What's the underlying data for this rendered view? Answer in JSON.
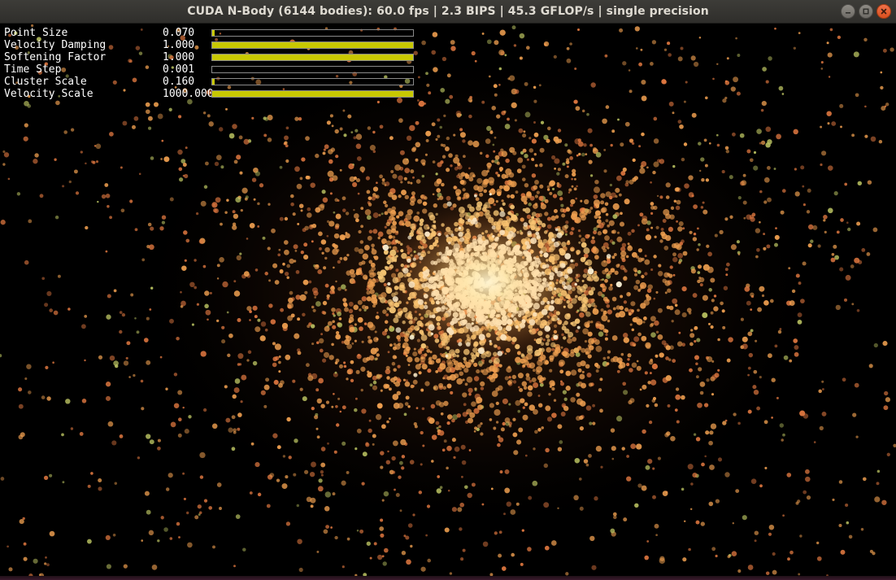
{
  "window": {
    "title": "CUDA N-Body (6144 bodies): 60.0 fps | 2.3 BIPS | 45.3 GFLOP/s | single precision",
    "buttons": {
      "minimize_icon": "minimize-icon",
      "maximize_icon": "maximize-icon",
      "close_icon": "close-icon"
    }
  },
  "parameters": [
    {
      "name": "Point Size",
      "value": "0.070",
      "level": 0.004
    },
    {
      "name": "Velocity Damping",
      "value": "1.000",
      "level": 1.0
    },
    {
      "name": "Softening Factor",
      "value": "1.000",
      "level": 1.0
    },
    {
      "name": "Time Step",
      "value": "0.001",
      "level": 0.0
    },
    {
      "name": "Cluster Scale",
      "value": "0.160",
      "level": 0.012
    },
    {
      "name": "Velocity Scale",
      "value": "1000.000",
      "level": 1.0
    }
  ],
  "simulation": {
    "bodies": 6144,
    "colors": {
      "core": "#fff6d8",
      "inner": "#ffcf7a",
      "mid": "#f0a050",
      "outer": "#e07840",
      "green_tint": "#b8c060"
    }
  },
  "colors": {
    "slider_fill": "#c8c800",
    "slider_border": "#8a8a8a",
    "label_text": "#ffffff",
    "titlebar": "#3a3935",
    "close_button": "#e95420"
  }
}
